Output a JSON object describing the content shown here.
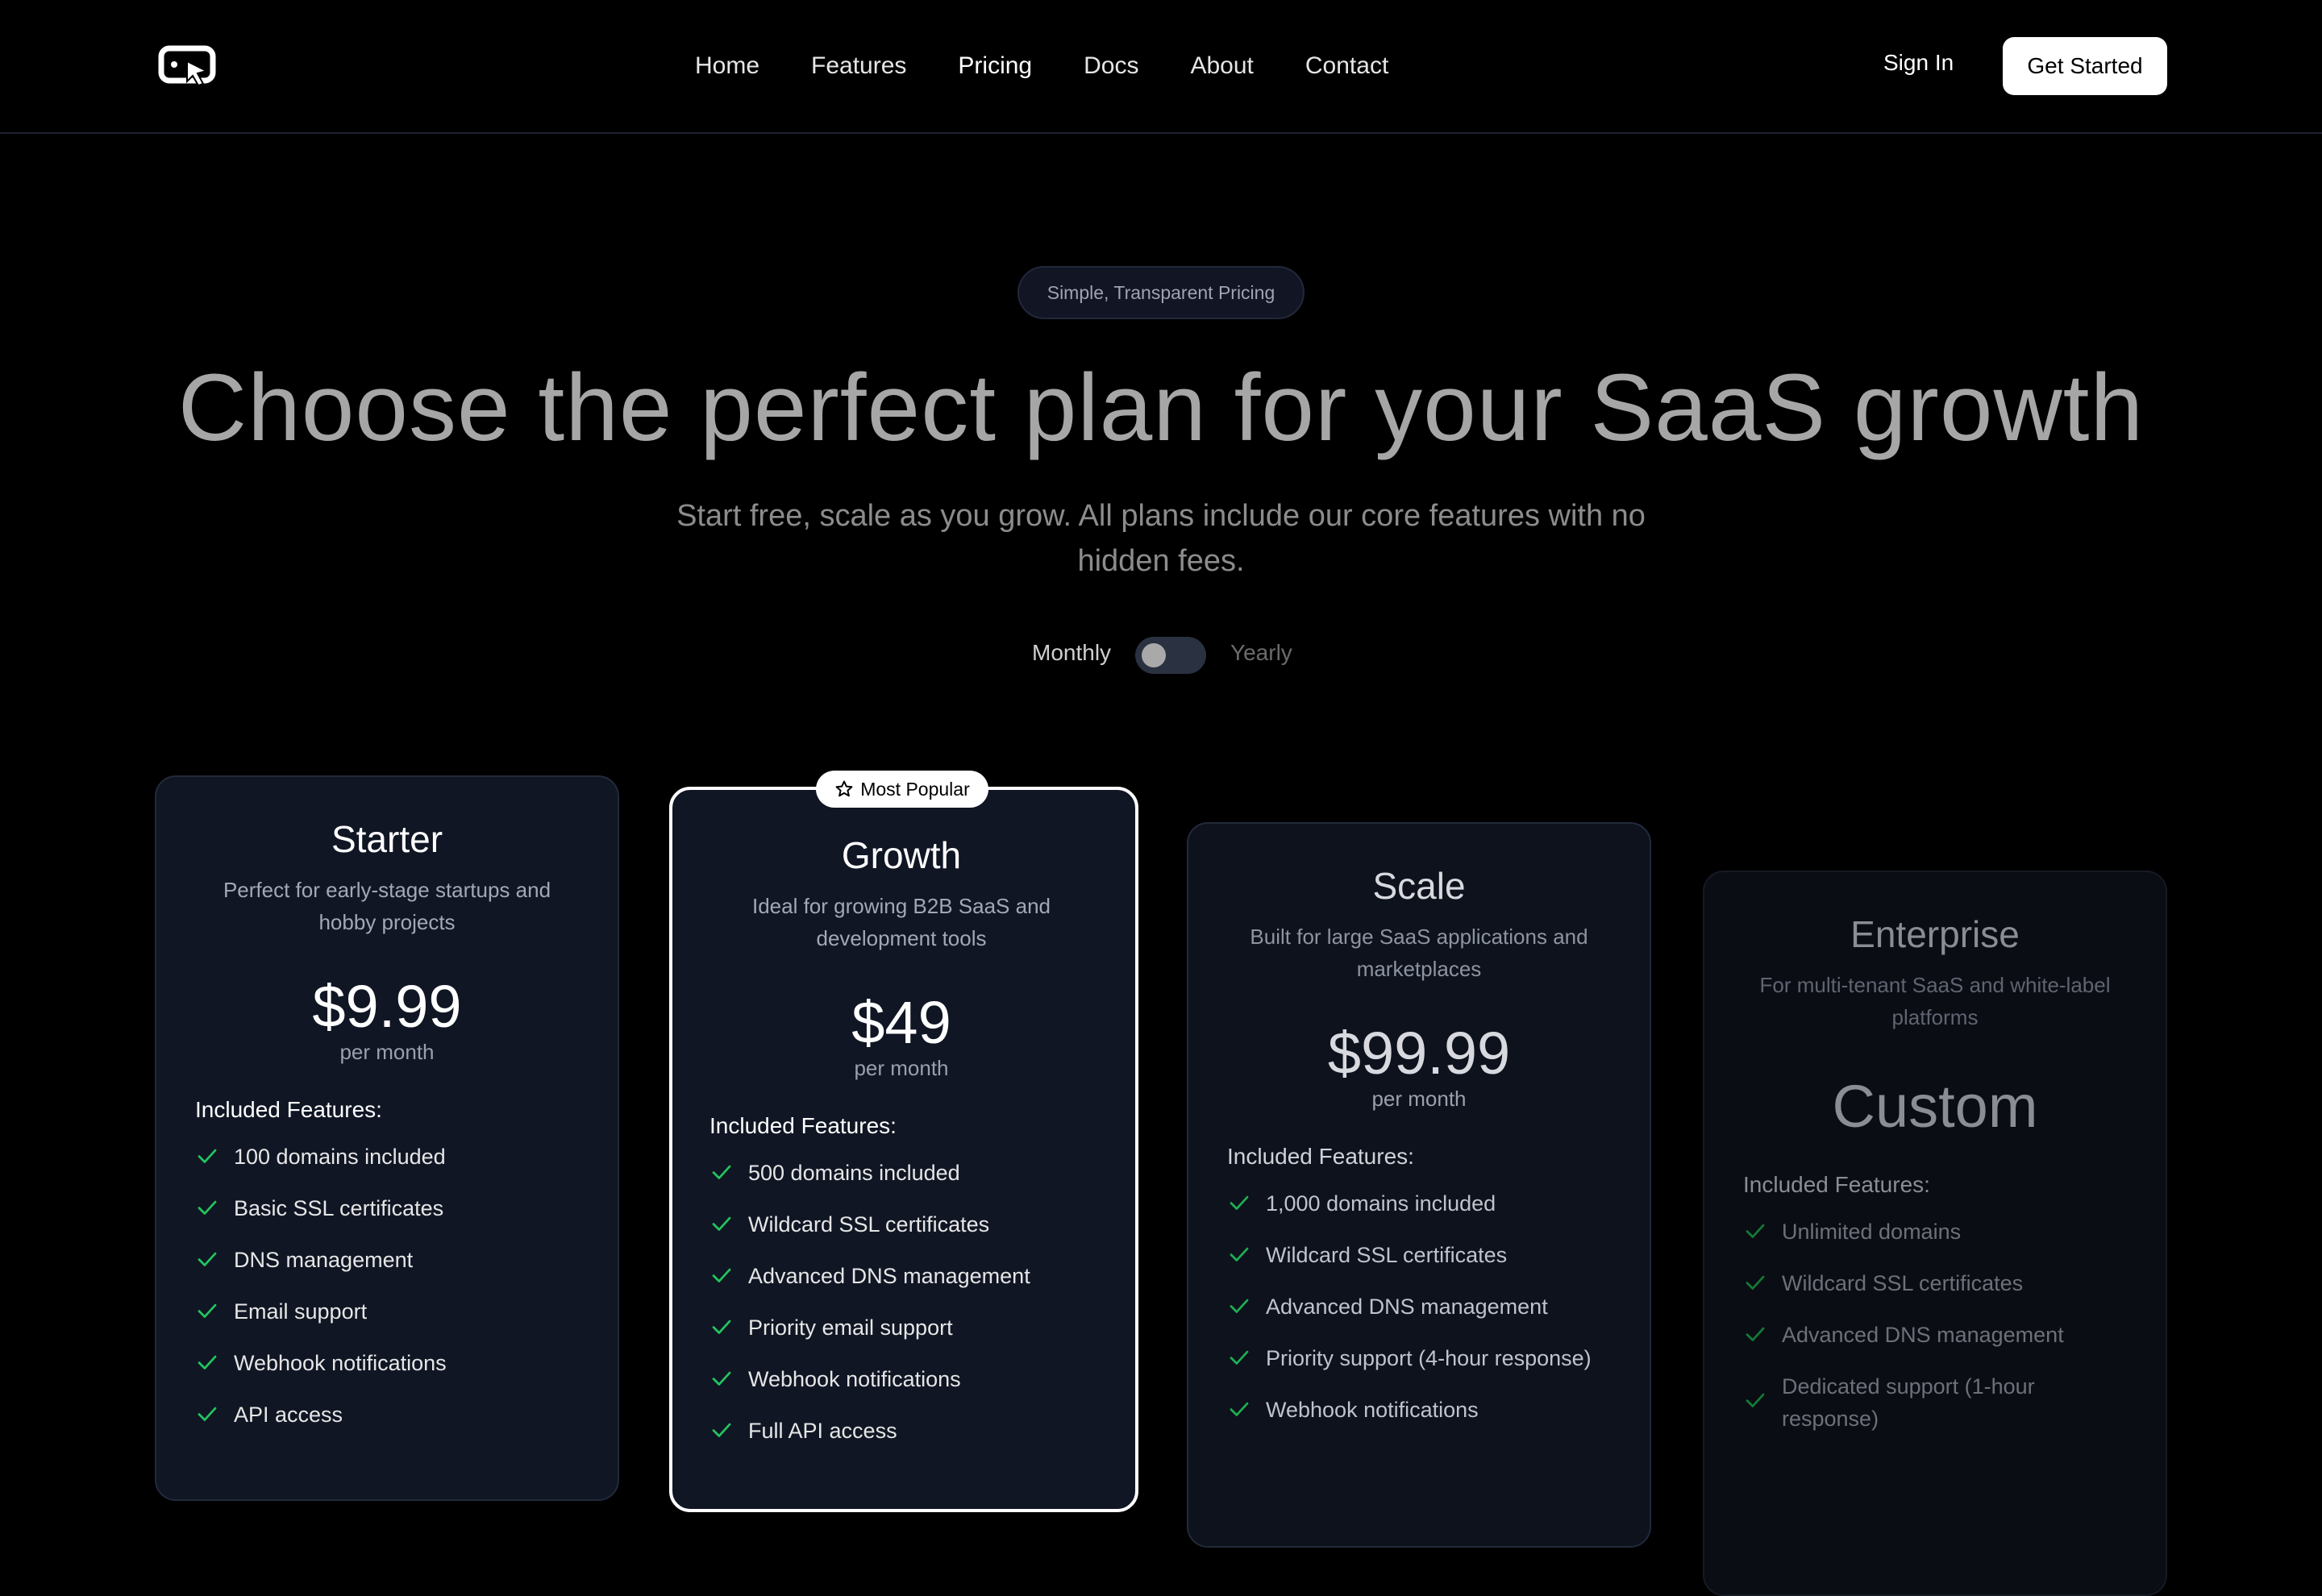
{
  "nav": {
    "logo": "cursor-logo-icon",
    "links": [
      {
        "label": "Home",
        "active": false
      },
      {
        "label": "Features",
        "active": false
      },
      {
        "label": "Pricing",
        "active": true
      },
      {
        "label": "Docs",
        "active": false
      },
      {
        "label": "About",
        "active": false
      },
      {
        "label": "Contact",
        "active": false
      }
    ],
    "sign_in": "Sign In",
    "get_started": "Get Started"
  },
  "hero": {
    "badge": "Simple, Transparent Pricing",
    "headline": "Choose the perfect plan for your SaaS growth",
    "subtitle": "Start free, scale as you grow. All plans include our core features with no hidden fees.",
    "toggle": {
      "monthly": "Monthly",
      "yearly": "Yearly",
      "selected": "Monthly"
    }
  },
  "popular_badge": "Most Popular",
  "colors": {
    "check": "#22c55e",
    "background": "#000000",
    "card": "#101624"
  },
  "plans": [
    {
      "name": "Starter",
      "description": "Perfect for early-stage startups and hobby projects",
      "price": "$9.99",
      "period": "per month",
      "features_title": "Included Features:",
      "features": [
        "100 domains included",
        "Basic SSL certificates",
        "DNS management",
        "Email support",
        "Webhook notifications",
        "API access"
      ]
    },
    {
      "name": "Growth",
      "description": "Ideal for growing B2B SaaS and development tools",
      "price": "$49",
      "period": "per month",
      "features_title": "Included Features:",
      "features": [
        "500 domains included",
        "Wildcard SSL certificates",
        "Advanced DNS management",
        "Priority email support",
        "Webhook notifications",
        "Full API access"
      ]
    },
    {
      "name": "Scale",
      "description": "Built for large SaaS applications and marketplaces",
      "price": "$99.99",
      "period": "per month",
      "features_title": "Included Features:",
      "features": [
        "1,000 domains included",
        "Wildcard SSL certificates",
        "Advanced DNS management",
        "Priority support (4-hour response)",
        "Webhook notifications"
      ]
    },
    {
      "name": "Enterprise",
      "description": "For multi-tenant SaaS and white-label platforms",
      "price": "Custom",
      "period": "",
      "features_title": "Included Features:",
      "features": [
        "Unlimited domains",
        "Wildcard SSL certificates",
        "Advanced DNS management",
        "Dedicated support (1-hour response)"
      ]
    }
  ]
}
